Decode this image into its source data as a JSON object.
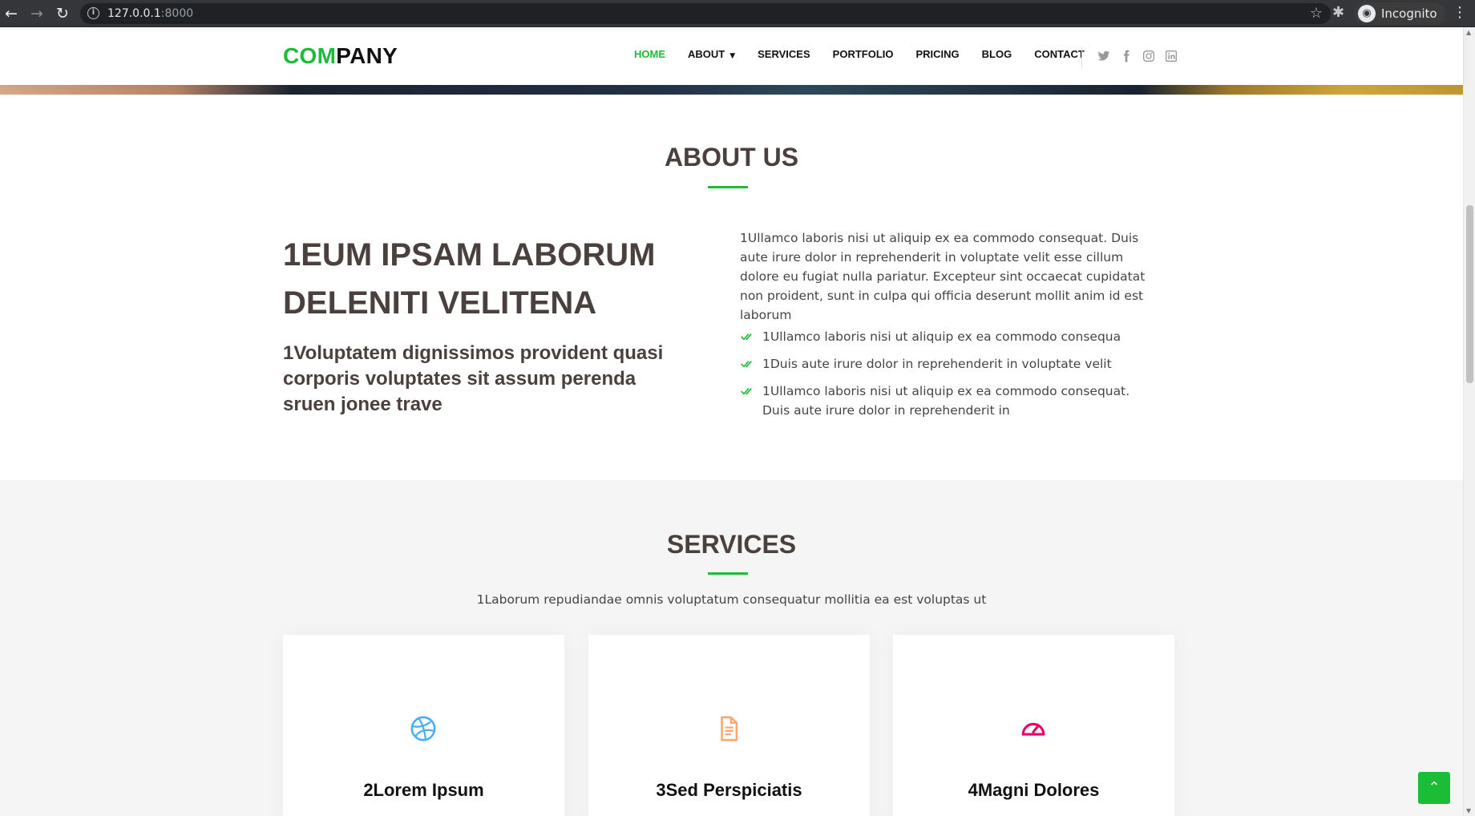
{
  "browser": {
    "url_host": "127.0.0.1",
    "url_port": ":8000",
    "profile_label": "Incognito"
  },
  "header": {
    "logo_accent": "COM",
    "logo_rest": "PANY",
    "nav": {
      "home": "HOME",
      "about": "ABOUT",
      "services": "SERVICES",
      "portfolio": "PORTFOLIO",
      "pricing": "PRICING",
      "blog": "BLOG",
      "contact": "CONTACT"
    },
    "socials": [
      "twitter-icon",
      "facebook-icon",
      "instagram-icon",
      "linkedin-icon"
    ]
  },
  "about": {
    "title": "ABOUT US",
    "heading": "1EUM IPSAM LABORUM DELENITI VELITENA",
    "subheading": "1Voluptatem dignissimos provident quasi corporis voluptates sit assum perenda sruen jonee trave",
    "paragraph": "1Ullamco laboris nisi ut aliquip ex ea commodo consequat. Duis aute irure dolor in reprehenderit in voluptate velit esse cillum dolore eu fugiat nulla pariatur. Excepteur sint occaecat cupidatat non proident, sunt in culpa qui officia deserunt mollit anim id est laborum",
    "list": [
      "1Ullamco laboris nisi ut aliquip ex ea commodo consequa",
      "1Duis aute irure dolor in reprehenderit in voluptate velit",
      "1Ullamco laboris nisi ut aliquip ex ea commodo consequat. Duis aute irure dolor in reprehenderit in"
    ]
  },
  "services": {
    "title": "SERVICES",
    "subtitle": "1Laborum repudiandae omnis voluptatum consequatur mollitia ea est voluptas ut",
    "cards": [
      {
        "title": "2Lorem Ipsum",
        "icon": "dribbble-icon",
        "color": "#47aeff"
      },
      {
        "title": "3Sed Perspiciatis",
        "icon": "file-text-icon",
        "color": "#ffa76e"
      },
      {
        "title": "4Magni Dolores",
        "icon": "speedometer-icon",
        "color": "#e80368"
      }
    ]
  },
  "colors": {
    "accent": "#1bbd36",
    "heading": "#4a403d"
  }
}
